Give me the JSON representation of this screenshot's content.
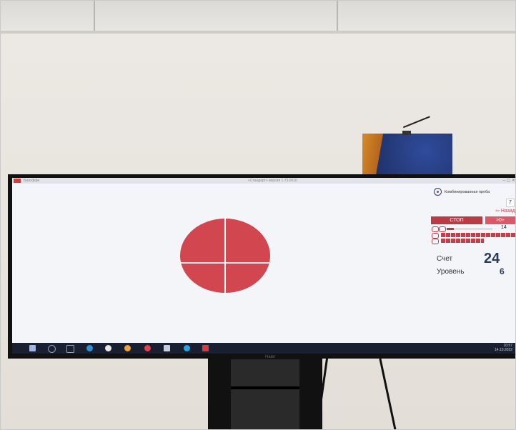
{
  "colors": {
    "wall": "#ece9e4",
    "screen_bg": "#f4f5f9",
    "circle": "#d24650",
    "dot": "#f1e100",
    "accent_red": "#b93b46",
    "taskbar": "#182032"
  },
  "window": {
    "title": "«Стандарт» версия 1.73.0010",
    "app_label": "Бизоффи",
    "controls": "–  ▢  ✕"
  },
  "panel": {
    "mode_label": "Комбинированная проба",
    "number": "7",
    "back_label": "⇦ Назад",
    "stop_label": "СТОП",
    "go_label": ">0+",
    "slider_value": "14",
    "slider_level": 0.15,
    "score_label": "Счет",
    "score_value": "24",
    "level_label": "Уровень",
    "level_value": "6"
  },
  "taskbar": {
    "icons": [
      "start-icon",
      "search-icon",
      "taskview-icon",
      "edge-icon",
      "yandex-icon",
      "app-orange-icon",
      "app-red-icon",
      "mail-icon",
      "telegram-icon",
      "active-app-icon"
    ],
    "time": "10:57",
    "date": "14.10.2022"
  },
  "monitor": {
    "brand": "Haier"
  }
}
